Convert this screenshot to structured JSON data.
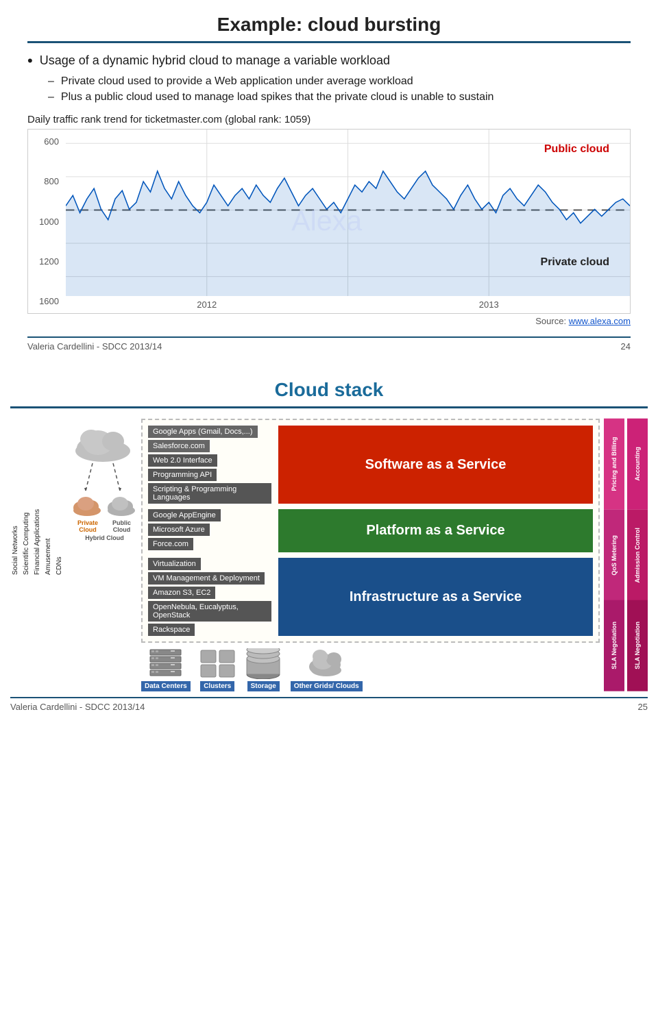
{
  "slide1": {
    "title": "Example: cloud bursting",
    "bullets": [
      {
        "main": "Usage of a dynamic hybrid cloud to manage a variable workload",
        "subs": [
          "Private cloud used to provide a Web application under average workload",
          "Plus a public cloud used to manage load spikes that the private cloud is unable to sustain"
        ]
      }
    ],
    "chart": {
      "label": "Daily traffic rank trend for ticketmaster.com (global rank: 1059)",
      "y_labels": [
        "600",
        "800",
        "1000",
        "1200",
        "1600"
      ],
      "x_labels": [
        "2012",
        "2013"
      ],
      "public_cloud_label": "Public cloud",
      "private_cloud_label": "Private cloud",
      "source_text": "Source: ",
      "source_link": "www.alexa.com"
    },
    "footer": {
      "left": "Valeria Cardellini - SDCC 2013/14",
      "right": "24"
    }
  },
  "slide2": {
    "title": "Cloud stack",
    "vertical_labels": [
      "Social Networks",
      "Scientific Computing",
      "Financial Applications",
      "Amusement",
      "CDNs"
    ],
    "cloud_labels": {
      "private": "Private Cloud",
      "public": "Public Cloud",
      "hybrid": "Hybrid Cloud"
    },
    "saas": {
      "service_label": "Software as a Service",
      "items": [
        "Google Apps (Gmail, Docs,...)",
        "Salesforce.com",
        "Web 2.0 Interface",
        "Programming API",
        "Scripting & Programming Languages"
      ]
    },
    "paas": {
      "service_label": "Platform as a Service",
      "items": [
        "Google AppEngine",
        "Microsoft Azure",
        "Force.com"
      ]
    },
    "iaas": {
      "service_label": "Infrastructure as a Service",
      "items": [
        "Virtualization",
        "VM Management & Deployment",
        "Amazon S3, EC2",
        "OpenNebula, Eucalyptus, OpenStack",
        "Rackspace"
      ]
    },
    "infra_icons": [
      {
        "label": "Data Centers"
      },
      {
        "label": "Clusters"
      },
      {
        "label": "Storage"
      },
      {
        "label": "Other Grids/ Clouds"
      }
    ],
    "right_bars": {
      "col1": [
        "Pricing and Billing",
        "QoS Metering",
        "SLA Negotiation"
      ],
      "col2": [
        "Accounting",
        "Admission Control",
        "SLA Negotiation"
      ]
    },
    "footer": {
      "left": "Valeria Cardellini - SDCC 2013/14",
      "right": "25"
    }
  }
}
